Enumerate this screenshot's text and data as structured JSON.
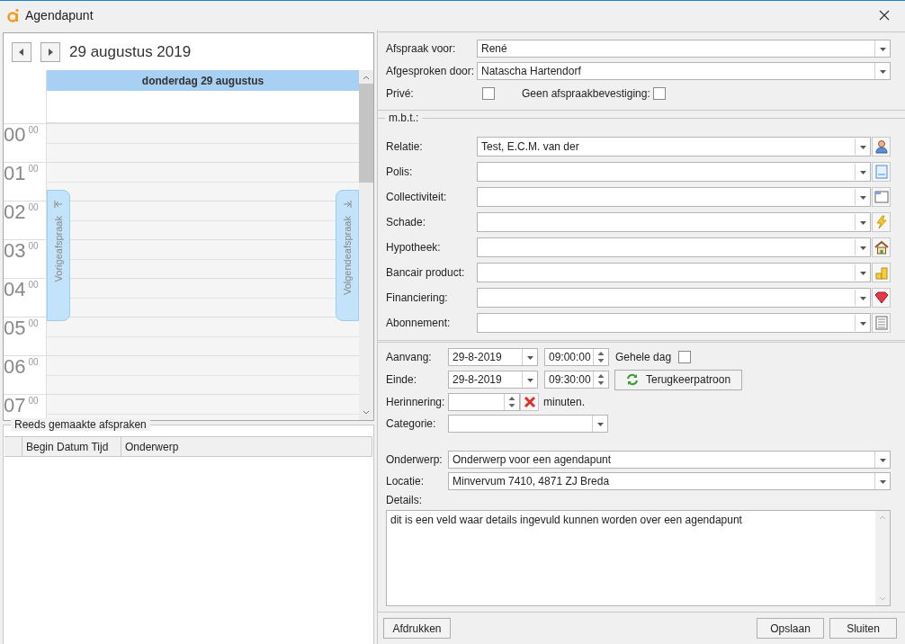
{
  "window": {
    "title": "Agendapunt"
  },
  "calendar": {
    "date_title": "29 augustus 2019",
    "day_header": "donderdag 29 augustus",
    "previous_tab": "Vorigeafspraak",
    "next_tab": "Volgendeafspraak",
    "hours": [
      {
        "hour": "00",
        "minutes": "00"
      },
      {
        "hour": "01",
        "minutes": "00"
      },
      {
        "hour": "02",
        "minutes": "00"
      },
      {
        "hour": "03",
        "minutes": "00"
      },
      {
        "hour": "04",
        "minutes": "00"
      },
      {
        "hour": "05",
        "minutes": "00"
      },
      {
        "hour": "06",
        "minutes": "00"
      },
      {
        "hour": "07",
        "minutes": "00"
      }
    ]
  },
  "appointments": {
    "title": "Reeds gemaakte afspraken",
    "columns": [
      "Begin Datum Tijd",
      "Onderwerp"
    ]
  },
  "assignment": {
    "fields": [
      {
        "label": "Afspraak voor:",
        "value": "René"
      },
      {
        "label": "Afgesproken door:",
        "value": "Natascha Hartendorf"
      }
    ],
    "private": {
      "label": "Privé:",
      "checked": false
    },
    "no_confirmation": {
      "label": "Geen afspraakbevestiging:",
      "checked": false
    }
  },
  "related": {
    "title": "m.b.t.:",
    "fields": [
      {
        "label": "Relatie:",
        "value": "Test, E.C.M. van der",
        "kind": "person"
      },
      {
        "label": "Polis:",
        "kind": "document"
      },
      {
        "label": "Collectiviteit:",
        "kind": "window"
      },
      {
        "label": "Schade:",
        "kind": "lightning"
      },
      {
        "label": "Hypotheek:",
        "kind": "house"
      },
      {
        "label": "Bancair product:",
        "kind": "coins"
      },
      {
        "label": "Financiering:",
        "kind": "gem"
      },
      {
        "label": "Abonnement:",
        "kind": "list"
      }
    ]
  },
  "schedule": {
    "start": {
      "label": "Aanvang:",
      "date": "29-8-2019",
      "time": "09:00:00"
    },
    "all_day": {
      "label": "Gehele dag",
      "checked": false
    },
    "end": {
      "label": "Einde:",
      "date": "29-8-2019",
      "time": "09:30:00"
    },
    "recurrence_button": "Terugkeerpatroon",
    "reminder": {
      "label": "Herinnering:",
      "unit": "minuten."
    },
    "category": {
      "label": "Categorie:"
    }
  },
  "subject": {
    "label": "Onderwerp:",
    "value": "Onderwerp voor een agendapunt"
  },
  "location": {
    "label": "Locatie:",
    "value": "Minvervum 7410, 4871 ZJ Breda"
  },
  "details": {
    "label": "Details:",
    "value": "dit is een veld waar details ingevuld kunnen worden over een agendapunt"
  },
  "footer": {
    "print_button": "Afdrukken",
    "actions": [
      "Opslaan",
      "Sluiten"
    ]
  }
}
